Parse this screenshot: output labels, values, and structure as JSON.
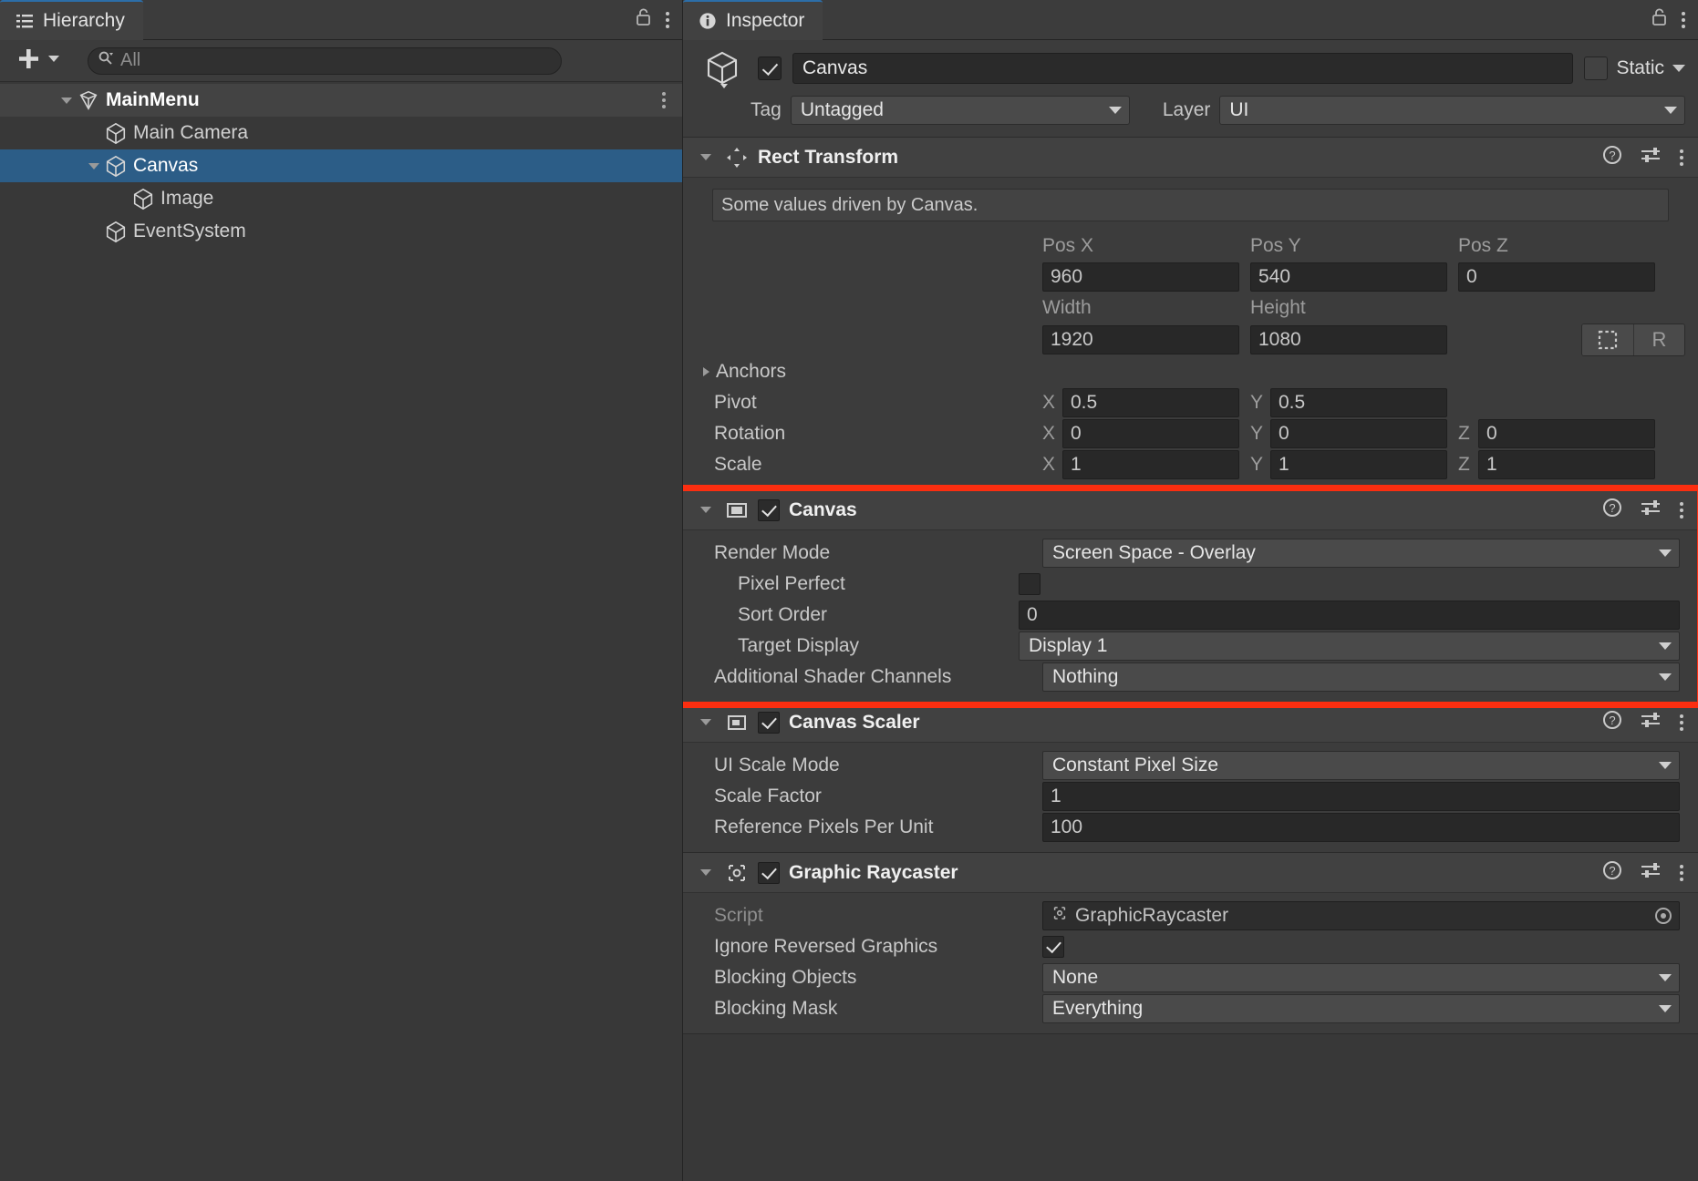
{
  "hierarchy": {
    "tab_label": "Hierarchy",
    "tab_icon": "hierarchy-icon",
    "lock_icon": "lock-open-icon",
    "menu_icon": "kebab-menu-icon",
    "toolbar": {
      "add_label": "+",
      "add_icon": "plus-icon",
      "add_caret_icon": "chevron-down-icon",
      "search_icon": "search-icon",
      "search_placeholder": "All",
      "search_value": ""
    },
    "tree": [
      {
        "label": "MainMenu",
        "depth": 0,
        "icon": "scene-icon",
        "expanded": true,
        "selected": false,
        "is_scene": true,
        "has_kebab": true
      },
      {
        "label": "Main Camera",
        "depth": 1,
        "icon": "gameobject-icon",
        "expanded": null,
        "selected": false,
        "is_scene": false,
        "has_kebab": false
      },
      {
        "label": "Canvas",
        "depth": 1,
        "icon": "gameobject-icon",
        "expanded": true,
        "selected": true,
        "is_scene": false,
        "has_kebab": false
      },
      {
        "label": "Image",
        "depth": 2,
        "icon": "gameobject-icon",
        "expanded": null,
        "selected": false,
        "is_scene": false,
        "has_kebab": false
      },
      {
        "label": "EventSystem",
        "depth": 1,
        "icon": "gameobject-icon",
        "expanded": null,
        "selected": false,
        "is_scene": false,
        "has_kebab": false
      }
    ]
  },
  "inspector": {
    "tab_label": "Inspector",
    "tab_icon": "info-icon",
    "lock_icon": "lock-open-icon",
    "menu_icon": "kebab-menu-icon",
    "object": {
      "enabled": true,
      "name": "Canvas",
      "prefab_icon": "gameobject-cube-icon",
      "static_label": "Static",
      "static_checked": false,
      "tag_label": "Tag",
      "tag_value": "Untagged",
      "layer_label": "Layer",
      "layer_value": "UI"
    },
    "components": [
      {
        "name": "Rect Transform",
        "icon": "rect-transform-icon",
        "expanded": true,
        "has_enable_toggle": false,
        "enabled": null,
        "note": "Some values driven by Canvas.",
        "col_headers": [
          "Pos X",
          "Pos Y",
          "Pos Z"
        ],
        "pos": [
          "960",
          "540",
          "0"
        ],
        "size_headers": [
          "Width",
          "Height"
        ],
        "size": [
          "1920",
          "1080"
        ],
        "anchor_preset_icon": "anchor-preset-icon",
        "raw_edit_label": "R",
        "anchors_label": "Anchors",
        "anchors_expanded": false,
        "pivot_label": "Pivot",
        "pivot": [
          "0.5",
          "0.5"
        ],
        "rotation_label": "Rotation",
        "rotation": [
          "0",
          "0",
          "0"
        ],
        "scale_label": "Scale",
        "scale": [
          "1",
          "1",
          "1"
        ],
        "axis_labels": [
          "X",
          "Y",
          "Z"
        ]
      },
      {
        "name": "Canvas",
        "icon": "canvas-icon",
        "expanded": true,
        "has_enable_toggle": true,
        "enabled": true,
        "highlighted": true,
        "fields": [
          {
            "label": "Render Mode",
            "type": "dropdown",
            "value": "Screen Space - Overlay",
            "indent": 0
          },
          {
            "label": "Pixel Perfect",
            "type": "checkbox",
            "value": false,
            "indent": 1
          },
          {
            "label": "Sort Order",
            "type": "number",
            "value": "0",
            "indent": 1
          },
          {
            "label": "Target Display",
            "type": "dropdown",
            "value": "Display 1",
            "indent": 1
          },
          {
            "label": "Additional Shader Channels",
            "type": "dropdown",
            "value": "Nothing",
            "indent": 0
          }
        ]
      },
      {
        "name": "Canvas Scaler",
        "icon": "canvas-scaler-icon",
        "expanded": true,
        "has_enable_toggle": true,
        "enabled": true,
        "fields": [
          {
            "label": "UI Scale Mode",
            "type": "dropdown",
            "value": "Constant Pixel Size",
            "indent": 0
          },
          {
            "label": "Scale Factor",
            "type": "number",
            "value": "1",
            "indent": 0
          },
          {
            "label": "Reference Pixels Per Unit",
            "type": "number",
            "value": "100",
            "indent": 0
          }
        ]
      },
      {
        "name": "Graphic Raycaster",
        "icon": "graphic-raycaster-icon",
        "expanded": true,
        "has_enable_toggle": true,
        "enabled": true,
        "fields": [
          {
            "label": "Script",
            "type": "object",
            "value": "GraphicRaycaster",
            "indent": 0,
            "disabled": true
          },
          {
            "label": "Ignore Reversed Graphics",
            "type": "checkbox",
            "value": true,
            "indent": 0
          },
          {
            "label": "Blocking Objects",
            "type": "dropdown",
            "value": "None",
            "indent": 0
          },
          {
            "label": "Blocking Mask",
            "type": "dropdown",
            "value": "Everything",
            "indent": 0
          }
        ]
      }
    ],
    "header_icons": {
      "help": "help-icon",
      "preset": "preset-icon",
      "menu": "kebab-menu-icon"
    }
  },
  "annotation": {
    "highlight_color": "#fb2e10",
    "target": "Canvas component"
  }
}
